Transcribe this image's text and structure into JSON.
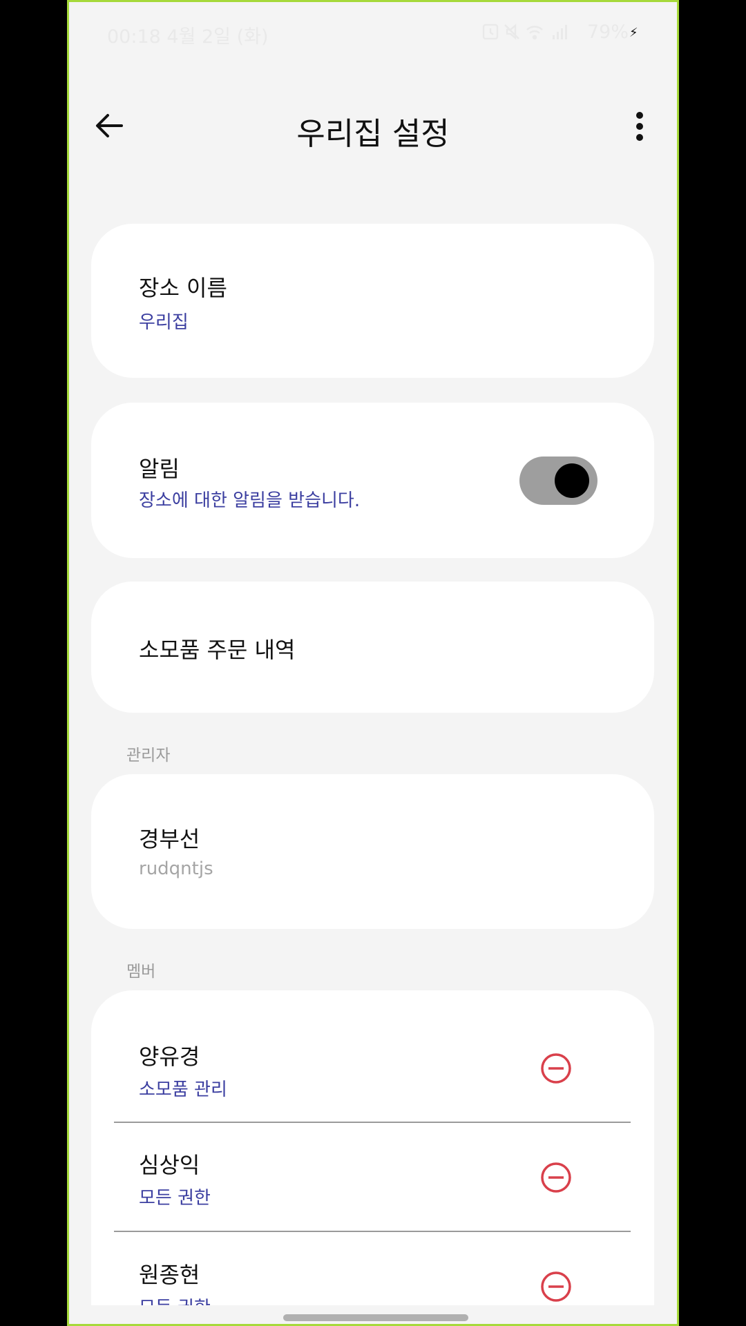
{
  "status_bar": {
    "time_date": "00:18   4월 2일 (화)",
    "icons": [
      "alarm-icon",
      "mute-icon",
      "wifi-icon",
      "signal-icon"
    ],
    "battery": "79%"
  },
  "app_bar": {
    "title": "우리집 설정"
  },
  "place_name": {
    "label": "장소 이름",
    "value": "우리집"
  },
  "notifications": {
    "label": "알림",
    "description": "장소에 대한 알림을 받습니다.",
    "enabled": true
  },
  "order_history": {
    "label": "소모품 주문 내역"
  },
  "admin_section": {
    "header": "관리자",
    "name": "경부선",
    "id": "rudqntjs"
  },
  "members_section": {
    "header": "멤버",
    "members": [
      {
        "name": "양유경",
        "role": "소모품 관리"
      },
      {
        "name": "심상익",
        "role": "모든 권한"
      },
      {
        "name": "원종현",
        "role": "모든 권한"
      }
    ]
  },
  "colors": {
    "accent": "#3b3ea0",
    "remove": "#d9404b",
    "frame": "#a6d93a"
  }
}
